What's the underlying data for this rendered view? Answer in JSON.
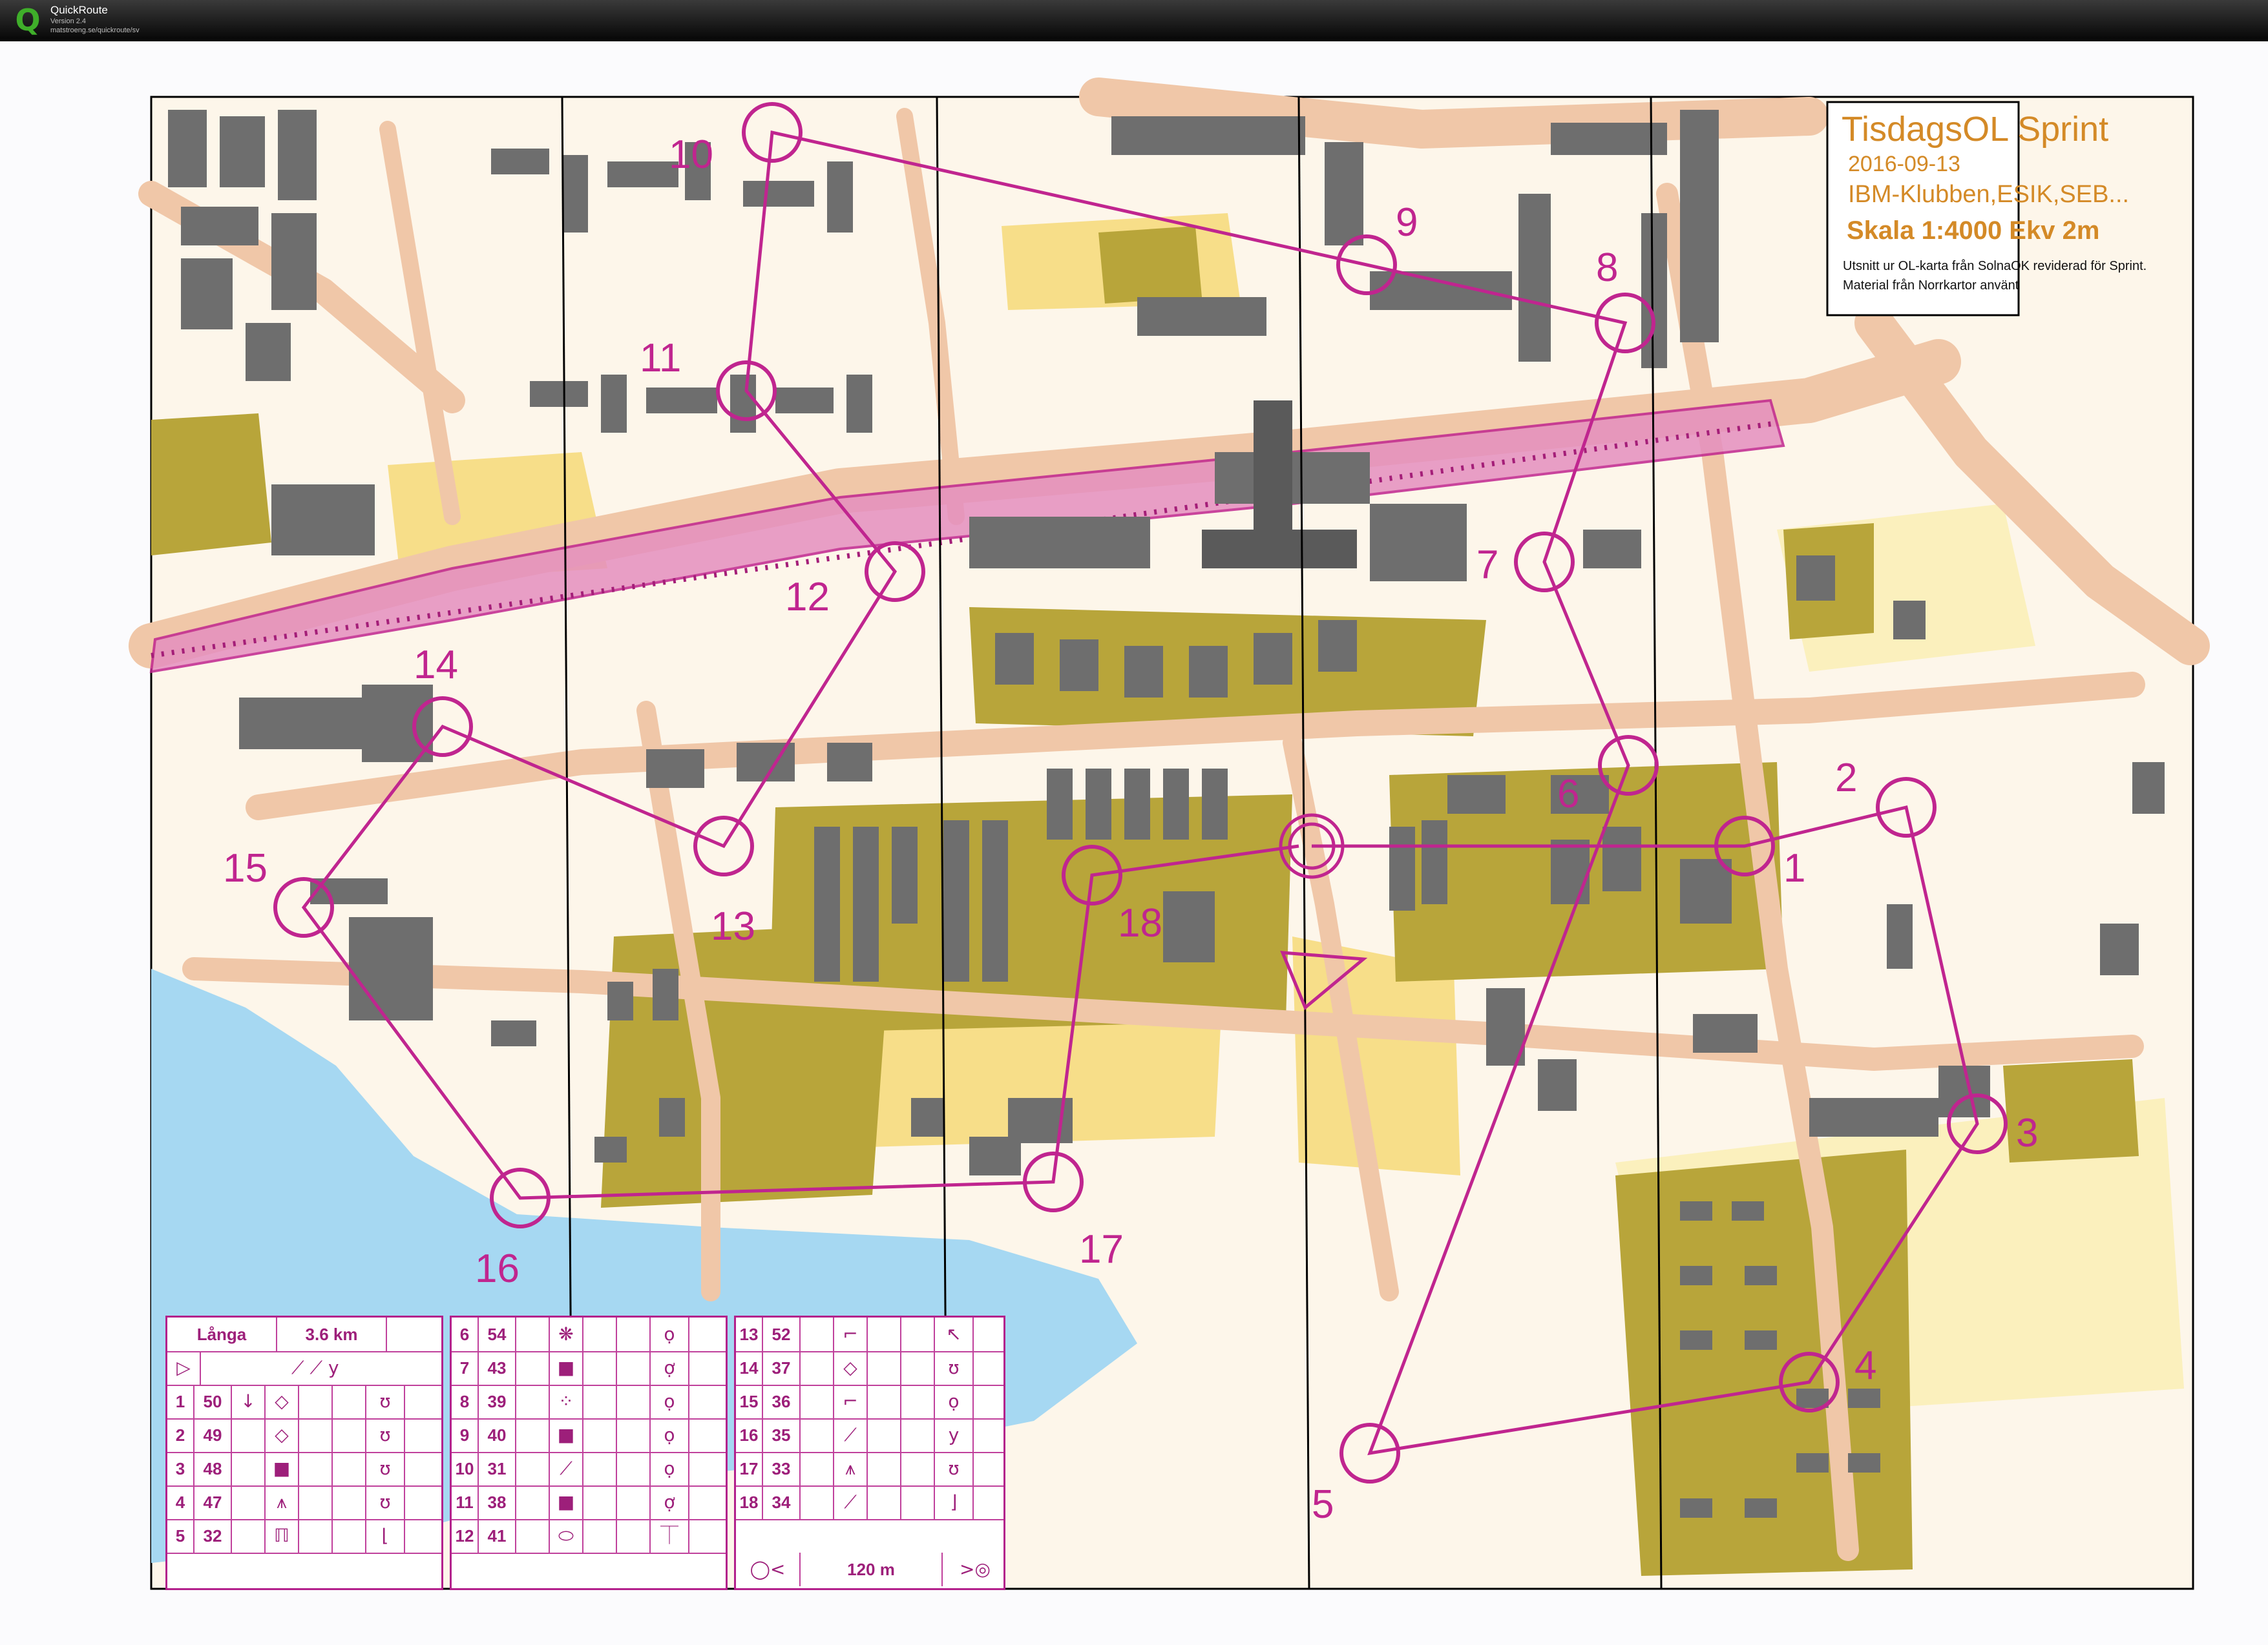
{
  "window": {
    "app_name": "QuickRoute",
    "version": "Version 2.4",
    "url": "matstroeng.se/quickroute/sv"
  },
  "map_info": {
    "event": "TisdagsOL Sprint",
    "date": "2016-09-13",
    "clubs": "IBM-Klubben,ESIK,SEB...",
    "scale": "Skala 1:4000 Ekv 2m",
    "note_line1": "Utsnitt ur OL-karta från SolnaOK reviderad för Sprint.",
    "note_line2": "Material från Norrkartor använt"
  },
  "colors": {
    "course": "#c0258f",
    "road": "#f0c7a8",
    "building": "#6b6b6b",
    "vegetation": "#b8a53a",
    "open_land": "#f5d873",
    "water": "#9fd3ee",
    "railway": "#d6539a",
    "contour": "#c86f2a"
  },
  "controls": [
    {
      "label": "1"
    },
    {
      "label": "2"
    },
    {
      "label": "3"
    },
    {
      "label": "4"
    },
    {
      "label": "5"
    },
    {
      "label": "6"
    },
    {
      "label": "7"
    },
    {
      "label": "8"
    },
    {
      "label": "9"
    },
    {
      "label": "10"
    },
    {
      "label": "11"
    },
    {
      "label": "12"
    },
    {
      "label": "13"
    },
    {
      "label": "14"
    },
    {
      "label": "15"
    },
    {
      "label": "16"
    },
    {
      "label": "17"
    },
    {
      "label": "18"
    }
  ],
  "control_table": {
    "course_name": "Långa",
    "distance": "3.6 km",
    "finish_distance": "120 m",
    "col1": [
      {
        "num": "1",
        "code": "50",
        "sym": "↓",
        "sym2": "◇",
        "sym3": "ʊ"
      },
      {
        "num": "2",
        "code": "49",
        "sym": "",
        "sym2": "◇",
        "sym3": "ʊ"
      },
      {
        "num": "3",
        "code": "48",
        "sym": "",
        "sym2": "■",
        "sym3": "ʊ"
      },
      {
        "num": "4",
        "code": "47",
        "sym": "",
        "sym2": "⩚",
        "sym3": "ʊ"
      },
      {
        "num": "5",
        "code": "32",
        "sym": "",
        "sym2": "ℿ",
        "sym3": "⌊"
      }
    ],
    "col2": [
      {
        "num": "6",
        "code": "54",
        "sym2": "❋",
        "sym3": "ọ"
      },
      {
        "num": "7",
        "code": "43",
        "sym2": "■",
        "sym3": "ợ"
      },
      {
        "num": "8",
        "code": "39",
        "sym2": "⁘",
        "sym3": "ọ"
      },
      {
        "num": "9",
        "code": "40",
        "sym2": "■",
        "sym3": "ọ"
      },
      {
        "num": "10",
        "code": "31",
        "sym2": "⟋",
        "sym3": "ọ"
      },
      {
        "num": "11",
        "code": "38",
        "sym2": "■",
        "sym3": "ợ"
      },
      {
        "num": "12",
        "code": "41",
        "sym2": "⬭",
        "sym3": "⏉"
      }
    ],
    "col3": [
      {
        "num": "13",
        "code": "52",
        "sym2": "⌐",
        "sym3": "↖"
      },
      {
        "num": "14",
        "code": "37",
        "sym2": "◇",
        "sym3": "ʊ"
      },
      {
        "num": "15",
        "code": "36",
        "sym2": "⌐",
        "sym3": "ọ"
      },
      {
        "num": "16",
        "code": "35",
        "sym2": "⟋",
        "sym3": "y"
      },
      {
        "num": "17",
        "code": "33",
        "sym2": "⩚",
        "sym3": "ʊ"
      },
      {
        "num": "18",
        "code": "34",
        "sym2": "⟋",
        "sym3": "⌋"
      }
    ]
  }
}
